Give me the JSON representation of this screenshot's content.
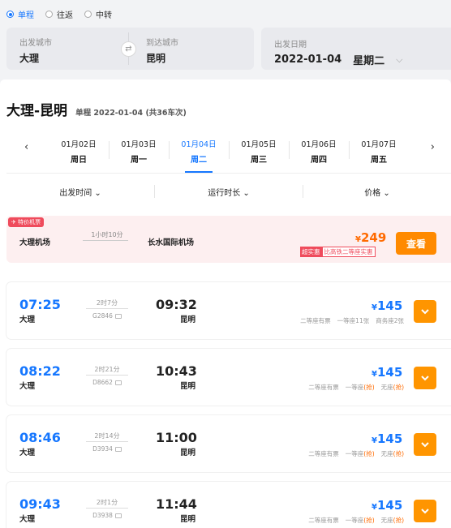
{
  "trip_types": [
    {
      "label": "单程",
      "selected": true
    },
    {
      "label": "往返",
      "selected": false
    },
    {
      "label": "中转",
      "selected": false
    }
  ],
  "search": {
    "from_label": "出发城市",
    "from_value": "大理",
    "to_label": "到达城市",
    "to_value": "昆明",
    "swap_icon": "swap-icon",
    "date_label": "出发日期",
    "date_value": "2022-01-04",
    "weekday_value": "星期二"
  },
  "route": {
    "title": "大理-昆明",
    "subtitle": "单程 2022-01-04 (共36车次)"
  },
  "date_tabs": [
    {
      "date": "01月02日",
      "weekday": "周日",
      "active": false
    },
    {
      "date": "01月03日",
      "weekday": "周一",
      "active": false
    },
    {
      "date": "01月04日",
      "weekday": "周二",
      "active": true
    },
    {
      "date": "01月05日",
      "weekday": "周三",
      "active": false
    },
    {
      "date": "01月06日",
      "weekday": "周四",
      "active": false
    },
    {
      "date": "01月07日",
      "weekday": "周五",
      "active": false
    }
  ],
  "sort_options": [
    "出发时间",
    "运行时长",
    "价格"
  ],
  "flight": {
    "tag": "✈ 特价机票",
    "dep_airport": "大理机场",
    "duration": "1小时10分",
    "arr_airport": "长水国际机场",
    "price": "249",
    "currency": "¥",
    "promo_badge": "超实惠",
    "promo_text": "比高铁二等座实惠",
    "view_label": "查看"
  },
  "trains": [
    {
      "dep_time": "07:25",
      "from": "大理",
      "duration": "2时7分",
      "train_no": "G2846",
      "arr_time": "09:32",
      "to": "昆明",
      "price": "145",
      "seats": [
        {
          "name": "二等座",
          "status": "有票",
          "grab": false
        },
        {
          "name": "一等座",
          "status": "11张",
          "grab": false
        },
        {
          "name": "商务座",
          "status": "2张",
          "grab": false
        }
      ]
    },
    {
      "dep_time": "08:22",
      "from": "大理",
      "duration": "2时21分",
      "train_no": "D8662",
      "arr_time": "10:43",
      "to": "昆明",
      "price": "145",
      "seats": [
        {
          "name": "二等座",
          "status": "有票",
          "grab": false
        },
        {
          "name": "一等座",
          "status": "(抢)",
          "grab": true
        },
        {
          "name": "无座",
          "status": "(抢)",
          "grab": true
        }
      ]
    },
    {
      "dep_time": "08:46",
      "from": "大理",
      "duration": "2时14分",
      "train_no": "D3934",
      "arr_time": "11:00",
      "to": "昆明",
      "price": "145",
      "seats": [
        {
          "name": "二等座",
          "status": "有票",
          "grab": false
        },
        {
          "name": "一等座",
          "status": "(抢)",
          "grab": true
        },
        {
          "name": "无座",
          "status": "(抢)",
          "grab": true
        }
      ]
    },
    {
      "dep_time": "09:43",
      "from": "大理",
      "duration": "2时1分",
      "train_no": "D3938",
      "arr_time": "11:44",
      "to": "昆明",
      "price": "145",
      "seats": [
        {
          "name": "二等座",
          "status": "有票",
          "grab": false
        },
        {
          "name": "一等座",
          "status": "(抢)",
          "grab": true
        },
        {
          "name": "无座",
          "status": "(抢)",
          "grab": true
        }
      ]
    }
  ],
  "colors": {
    "accent": "#1677ff",
    "price_orange": "#ff6a00",
    "button_orange": "#ff9500",
    "promo_red": "#ef4b5c"
  }
}
